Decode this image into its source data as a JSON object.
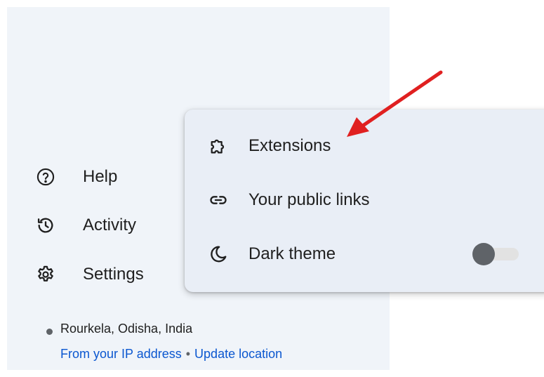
{
  "nav": {
    "items": [
      {
        "label": "Help",
        "icon": "help-circle-icon"
      },
      {
        "label": "Activity",
        "icon": "history-icon"
      },
      {
        "label": "Settings",
        "icon": "gear-icon"
      }
    ]
  },
  "location": {
    "place": "Rourkela, Odisha, India",
    "source": "From your IP address",
    "separator": "•",
    "update_label": "Update location"
  },
  "menu": {
    "items": [
      {
        "label": "Extensions",
        "icon": "puzzle-icon"
      },
      {
        "label": "Your public links",
        "icon": "link-icon"
      },
      {
        "label": "Dark theme",
        "icon": "moon-icon"
      }
    ],
    "dark_theme_enabled": false
  },
  "colors": {
    "sidebar_bg": "#f0f4f9",
    "menu_bg": "#e9eef6",
    "link": "#0b57d0",
    "annotation_arrow": "#e02020"
  }
}
